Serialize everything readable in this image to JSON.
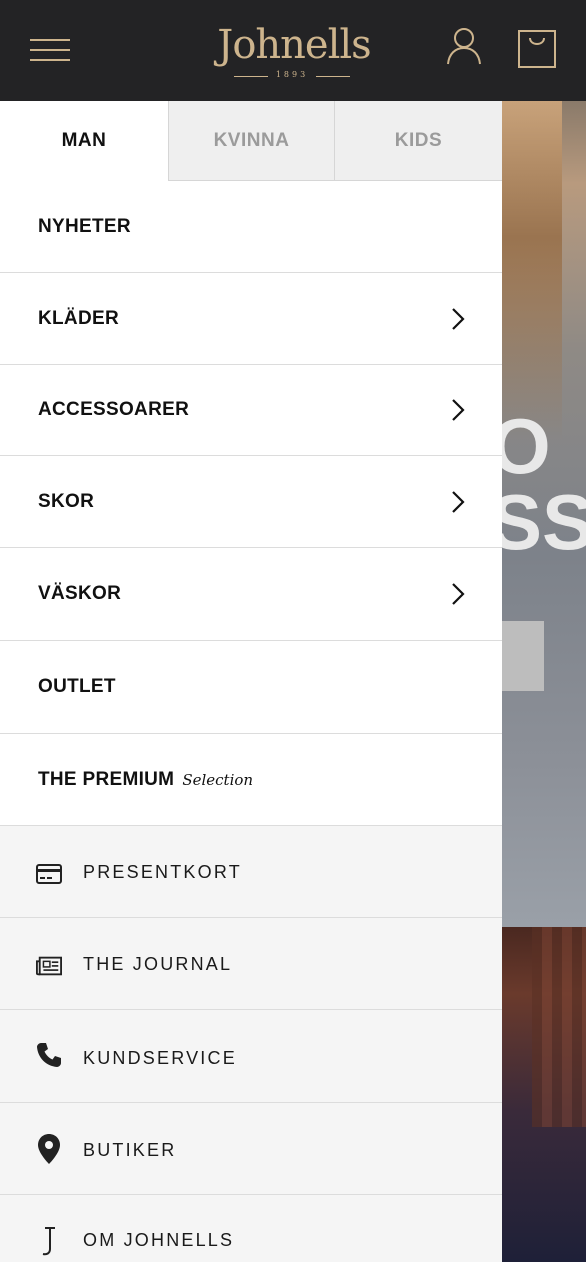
{
  "header": {
    "logo_text": "Johnells",
    "logo_year": "1893",
    "menu_icon": "hamburger-icon",
    "account_icon": "user-icon",
    "cart_icon": "shopping-bag-icon",
    "accent_color": "#cdb48d",
    "background_color": "#232325"
  },
  "tabs": [
    {
      "label": "MAN",
      "active": true
    },
    {
      "label": "KVINNA",
      "active": false
    },
    {
      "label": "KIDS",
      "active": false
    }
  ],
  "menu": {
    "items": [
      {
        "label": "NYHETER",
        "has_submenu": false
      },
      {
        "label": "KLÄDER",
        "has_submenu": true
      },
      {
        "label": "ACCESSOARER",
        "has_submenu": true
      },
      {
        "label": "SKOR",
        "has_submenu": true
      },
      {
        "label": "VÄSKOR",
        "has_submenu": true
      },
      {
        "label": "OUTLET",
        "has_submenu": false
      }
    ],
    "premium": {
      "label": "THE PREMIUM",
      "suffix": "Selection"
    }
  },
  "secondary": [
    {
      "label": "PRESENTKORT",
      "icon": "gift-card-icon"
    },
    {
      "label": "THE JOURNAL",
      "icon": "newspaper-icon"
    },
    {
      "label": "KUNDSERVICE",
      "icon": "phone-icon"
    },
    {
      "label": "BUTIKER",
      "icon": "map-pin-icon"
    },
    {
      "label": "OM JOHNELLS",
      "icon": "johnells-j-icon"
    }
  ],
  "hero": {
    "text_line1": "O",
    "text_line2": "SS"
  }
}
